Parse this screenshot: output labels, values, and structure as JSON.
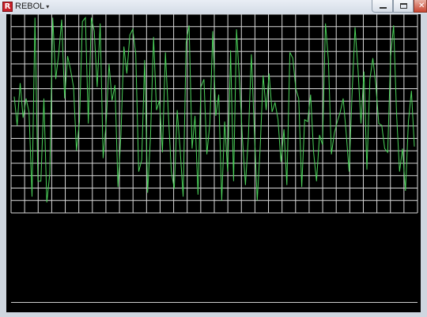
{
  "window": {
    "app_icon_letter": "R",
    "title": "REBOL",
    "title_menu_icon": "dropdown-arrow-icon"
  },
  "controls": {
    "minimize": "minimize-icon",
    "maximize": "maximize-icon",
    "close": "close-icon"
  },
  "colors": {
    "trace": "#4bd15a",
    "grid": "#d9d9d9",
    "background": "#000000"
  },
  "chart_data": {
    "type": "line",
    "grid": true,
    "grid_columns": 30,
    "grid_rows": 16,
    "ylim": [
      0,
      100
    ],
    "values": [
      58,
      43,
      65,
      47,
      57,
      50,
      6,
      99,
      14,
      14,
      57,
      3,
      18,
      99,
      67,
      80,
      98,
      57,
      79,
      72,
      63,
      30,
      45,
      97,
      99,
      44,
      99,
      92,
      63,
      96,
      26,
      44,
      75,
      56,
      64,
      11,
      38,
      84,
      70,
      90,
      93,
      80,
      19,
      25,
      77,
      8,
      38,
      89,
      51,
      56,
      29,
      81,
      49,
      19,
      10,
      51,
      30,
      6,
      86,
      95,
      31,
      48,
      7,
      63,
      67,
      28,
      44,
      92,
      48,
      59,
      4,
      45,
      19,
      82,
      14,
      93,
      66,
      36,
      12,
      37,
      80,
      41,
      4,
      32,
      69,
      51,
      70,
      50,
      55,
      46,
      24,
      41,
      12,
      81,
      78,
      62,
      57,
      11,
      46,
      45,
      59,
      29,
      14,
      38,
      33,
      96,
      77,
      28,
      39,
      45,
      50,
      57,
      39,
      19,
      60,
      94,
      72,
      44,
      71,
      20,
      67,
      78,
      64,
      44,
      43,
      31,
      29,
      79,
      95,
      49,
      19,
      31,
      9,
      45,
      61,
      32
    ]
  }
}
